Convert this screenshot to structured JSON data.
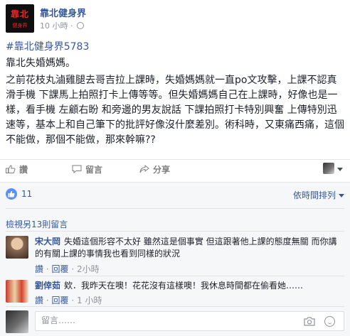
{
  "page": {
    "name": "靠北健身界",
    "avatar_text": "靠北",
    "avatar_subtext": "健身界"
  },
  "post": {
    "time": "10 小時",
    "hashtag": "#靠北健身界5783",
    "intro": "靠北失婚媽媽。",
    "content": "之前花枝丸滷雞腿去哥吉拉上課時，失婚媽媽就一直po文攻擊，上課不認真 滑手機 下課馬上拍照打卡上傳等等。但失婚媽媽自己在上課時，好像也是一樣，看手機 左顧右盼 和旁邊的男友說話 下課拍照打卡特別興奮 上傳特別迅速等，基本上和自己筆下的批評好像沒什麼差別。術科時，又東痛西痛，這個不能做，那個不能做，那來幹嘛??"
  },
  "actions": {
    "like": "讚",
    "comment": "留言",
    "share": "分享"
  },
  "reactions": {
    "count": "11",
    "sort_label": "依時間排列"
  },
  "comments_section": {
    "view_more": "檢視另13則留言",
    "items": [
      {
        "author": "宋大岡",
        "text": "失婚這個形容不太好  雖然這是個事實  但這跟著他上課的態度無關  而你講的有關上課的事情我也看到同樣的狀況",
        "like": "讚",
        "reply": "回覆",
        "time": "2小時"
      },
      {
        "author": "劉倖茹",
        "text": "欸．我昨天在噢！花花沒有這樣噢！我休息時間都在偷看她……",
        "like": "讚",
        "reply": "回覆",
        "time": "1 小時"
      }
    ],
    "separator": "·"
  },
  "composer": {
    "placeholder": "留言……"
  },
  "colors": {
    "link": "#365899",
    "meta": "#90949c",
    "comments_bg": "#f6f7f9",
    "brand_red": "#e8262b",
    "like_blue": "#5890ff"
  }
}
